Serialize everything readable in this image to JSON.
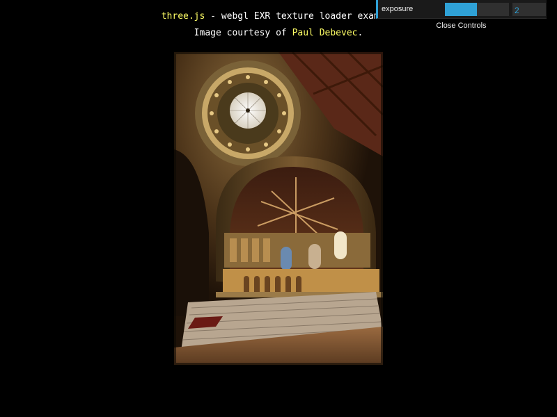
{
  "info": {
    "link_text": "three.js",
    "title_rest": " - webgl EXR texture loader example",
    "courtesy_prefix": "Image courtesy of ",
    "author_link": "Paul Debevec",
    "courtesy_suffix": "."
  },
  "gui": {
    "controls": [
      {
        "label": "exposure",
        "value": "2",
        "fill_fraction": 0.5
      }
    ],
    "close_label": "Close Controls"
  },
  "colors": {
    "link": "#ffff66",
    "accent": "#2fa1d6",
    "gui_bg": "#1a1a1a",
    "field_bg": "#303030"
  },
  "image": {
    "subject": "church interior HDR panorama (Stanford Memorial Church)"
  }
}
